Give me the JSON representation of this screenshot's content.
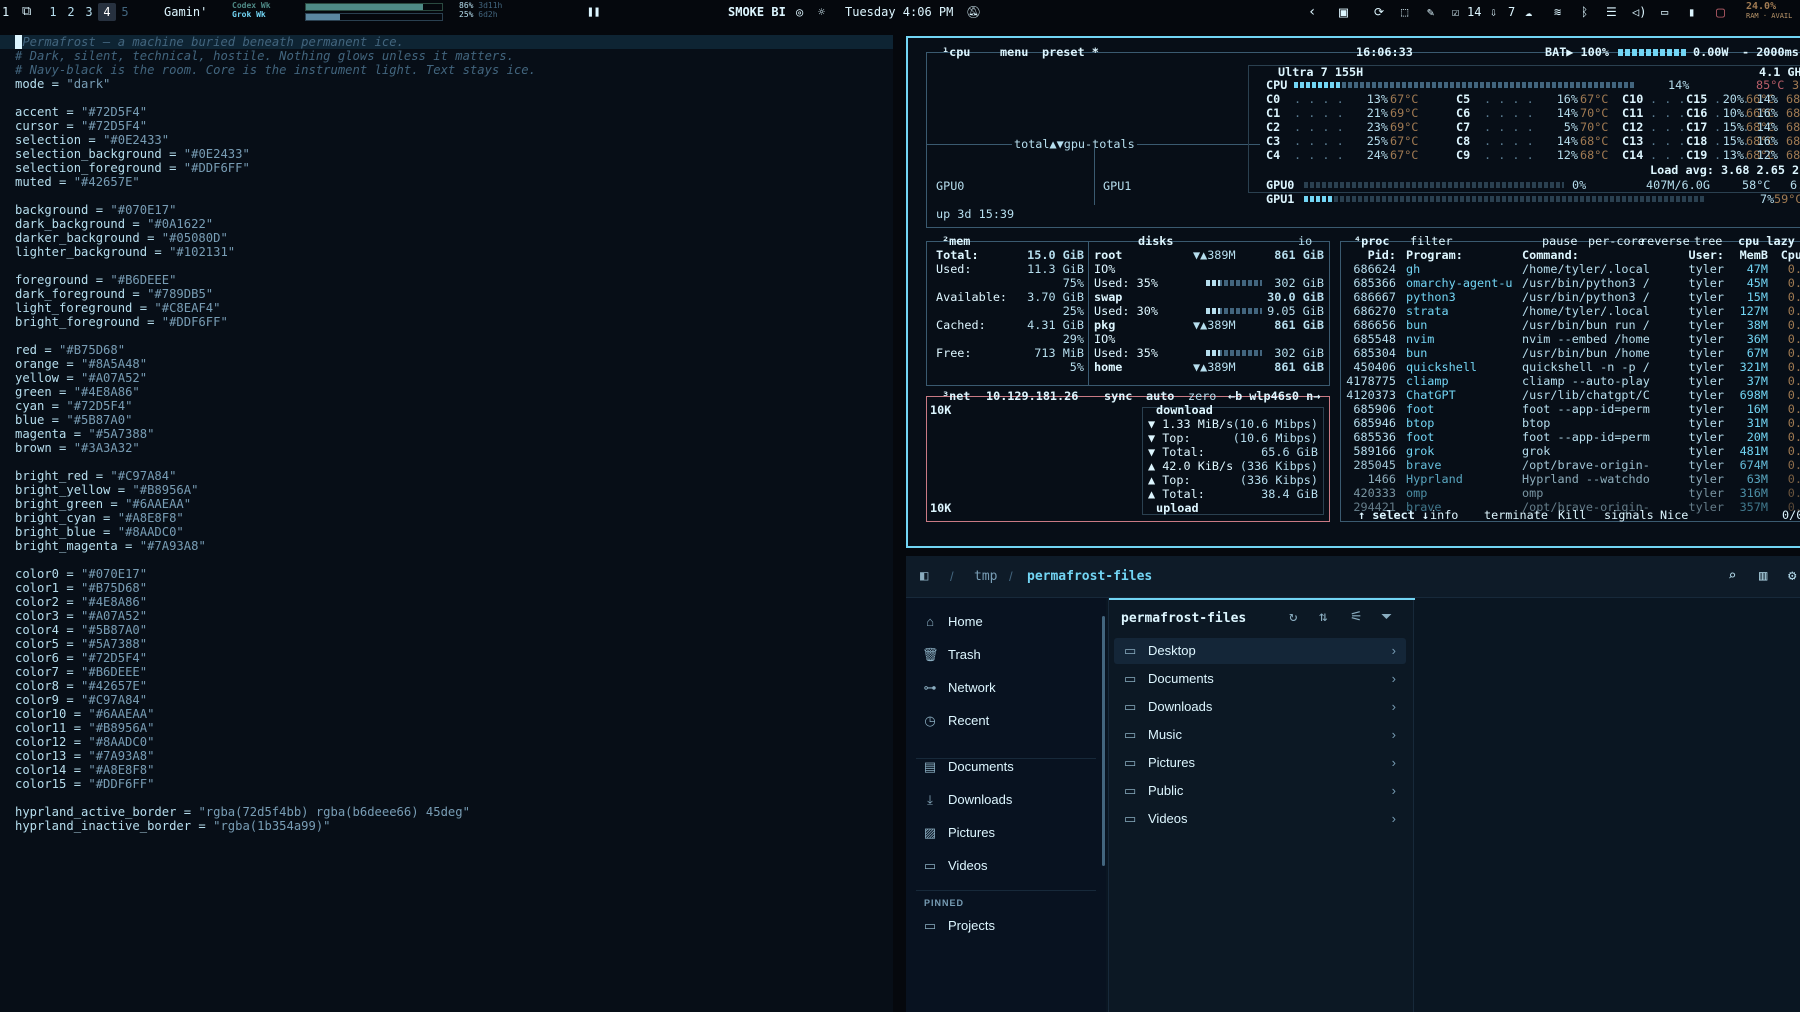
{
  "topbar": {
    "workspaces": [
      "1",
      "1",
      "2",
      "3",
      "4",
      "5"
    ],
    "active_workspace": "4",
    "window_title": "Gamin'",
    "usage_labels": [
      "Codex Wk",
      "Grok Wk"
    ],
    "usage_stats": [
      {
        "pct": "86%",
        "time": "3d11h"
      },
      {
        "pct": "25%",
        "time": "6d2h"
      }
    ],
    "usage_fill": [
      0.86,
      0.25
    ],
    "pause_icon": "pause-icon",
    "bi_label": "SMOKE BI",
    "clock": "Tuesday 4:06 PM",
    "tray_count_1": "14",
    "tray_count_2": "7",
    "cpu_pct": "24.0%",
    "ram_label": "RAM · AVAIL"
  },
  "editor": {
    "lines": [
      "Permafrost — a machine buried beneath permanent ice.",
      "# Dark, silent, technical, hostile. Nothing glows unless it matters.",
      "# Navy-black is the room. Core is the instrument light. Text stays ice.",
      "mode = \"dark\"",
      "",
      "accent = \"#72D5F4\"",
      "cursor = \"#72D5F4\"",
      "selection = \"#0E2433\"",
      "selection_background = \"#0E2433\"",
      "selection_foreground = \"#DDF6FF\"",
      "muted = \"#42657E\"",
      "",
      "background = \"#070E17\"",
      "dark_background = \"#0A1622\"",
      "darker_background = \"#05080D\"",
      "lighter_background = \"#102131\"",
      "",
      "foreground = \"#B6DEEE\"",
      "dark_foreground = \"#789DB5\"",
      "light_foreground = \"#C8EAF4\"",
      "bright_foreground = \"#DDF6FF\"",
      "",
      "red = \"#B75D68\"",
      "orange = \"#8A5A48\"",
      "yellow = \"#A07A52\"",
      "green = \"#4E8A86\"",
      "cyan = \"#72D5F4\"",
      "blue = \"#5B87A0\"",
      "magenta = \"#5A7388\"",
      "brown = \"#3A3A32\"",
      "",
      "bright_red = \"#C97A84\"",
      "bright_yellow = \"#B8956A\"",
      "bright_green = \"#6AAEAA\"",
      "bright_cyan = \"#A8E8F8\"",
      "bright_blue = \"#8AADC0\"",
      "bright_magenta = \"#7A93A8\"",
      "",
      "color0 = \"#070E17\"",
      "color1 = \"#B75D68\"",
      "color2 = \"#4E8A86\"",
      "color3 = \"#A07A52\"",
      "color4 = \"#5B87A0\"",
      "color5 = \"#5A7388\"",
      "color6 = \"#72D5F4\"",
      "color7 = \"#B6DEEE\"",
      "color8 = \"#42657E\"",
      "color9 = \"#C97A84\"",
      "color10 = \"#6AAEAA\"",
      "color11 = \"#B8956A\"",
      "color12 = \"#8AADC0\"",
      "color13 = \"#7A93A8\"",
      "color14 = \"#A8E8F8\"",
      "color15 = \"#DDF6FF\"",
      "",
      "hyprland_active_border = \"rgba(72d5f4bb) rgba(b6deee66) 45deg\"",
      "hyprland_inactive_border = \"rgba(1b354a99)\""
    ]
  },
  "btop": {
    "cpu_header": [
      "¹cpu",
      "menu",
      "preset *"
    ],
    "clock": "16:06:33",
    "battery": "BAT▶ 100%",
    "power": "0.00W",
    "interval": "- 2000ms",
    "gpu_totals": "total▲▼gpu-totals",
    "gpu0": "GPU0",
    "gpu1": "GPU1",
    "uptime": "up 3d 15:39",
    "cpu_model": "Ultra 7 155H",
    "cpu_freq": "4.1 GH",
    "cpu_total": {
      "label": "CPU",
      "pct": "14%",
      "temp": "85°C",
      "extra": "36"
    },
    "cores": [
      [
        "C0",
        "13%",
        "67°C",
        "C5",
        "16%",
        "67°C",
        "C10",
        "20%",
        "66°C",
        "C15",
        "14%",
        "68"
      ],
      [
        "C1",
        "21%",
        "69°C",
        "C6",
        "14%",
        "70°C",
        "C11",
        "10%",
        "66°C",
        "C16",
        "16%",
        "68"
      ],
      [
        "C2",
        "23%",
        "69°C",
        "C7",
        "5%",
        "70°C",
        "C12",
        "15%",
        "68°C",
        "C17",
        "14%",
        "68"
      ],
      [
        "C3",
        "25%",
        "67°C",
        "C8",
        "14%",
        "68°C",
        "C13",
        "15%",
        "68°C",
        "C18",
        "16%",
        "68"
      ],
      [
        "C4",
        "24%",
        "67°C",
        "C9",
        "12%",
        "68°C",
        "C14",
        "13%",
        "68°C",
        "C19",
        "12%",
        "68"
      ]
    ],
    "load_avg": "Load avg: 3.68 2.65 2.",
    "gpu0_row": {
      "label": "GPU0",
      "pct": "0%",
      "mem": "407M/6.0G",
      "temp": "58°C",
      "extra": "6."
    },
    "gpu1_row": {
      "label": "GPU1",
      "pct": "7%",
      "temp": "59°C"
    },
    "mem_header": "²mem",
    "mem": [
      [
        "Total:",
        "15.0 GiB"
      ],
      [
        "Used:",
        "11.3 GiB"
      ],
      [
        "",
        "75%"
      ],
      [
        "Available:",
        "3.70 GiB"
      ],
      [
        "",
        "25%"
      ],
      [
        "Cached:",
        "4.31 GiB"
      ],
      [
        "",
        "29%"
      ],
      [
        "Free:",
        "713 MiB"
      ],
      [
        "",
        "5%"
      ]
    ],
    "disks_header": "disks",
    "io_label": "io",
    "disks": [
      [
        "root",
        "▼▲389M",
        "861 GiB"
      ],
      [
        "IO%",
        "",
        ""
      ],
      [
        "Used: 35%",
        "",
        "302 GiB"
      ],
      [
        "swap",
        "",
        "30.0 GiB"
      ],
      [
        "Used: 30%",
        "",
        "9.05 GiB"
      ],
      [
        "pkg",
        "▼▲389M",
        "861 GiB"
      ],
      [
        "IO%",
        "",
        ""
      ],
      [
        "Used: 35%",
        "",
        "302 GiB"
      ],
      [
        "home",
        "▼▲389M",
        "861 GiB"
      ]
    ],
    "net_header": "³net",
    "net_ip": "10.129.181.26",
    "net_opts": [
      "sync",
      "auto",
      "zero",
      "←b wlp46s0 n→"
    ],
    "net_scale_top": "10K",
    "net_scale_bottom": "10K",
    "net": [
      [
        "download",
        ""
      ],
      [
        "▼ 1.33 MiB/s",
        "(10.6 Mibps)"
      ],
      [
        "▼ Top:",
        "(10.6 Mibps)"
      ],
      [
        "▼ Total:",
        "65.6 GiB"
      ],
      [
        "▲ 42.0 KiB/s",
        "(336 Kibps)"
      ],
      [
        "▲ Top:",
        "(336 Kibps)"
      ],
      [
        "▲ Total:",
        "38.4 GiB"
      ],
      [
        "upload",
        ""
      ]
    ],
    "proc_header": [
      "⁴proc",
      "filter",
      "pause",
      "per-core",
      "reverse",
      "tree",
      "cpu lazy"
    ],
    "proc_cols": [
      "Pid:",
      "Program:",
      "Command:",
      "User:",
      "MemB",
      "Cpu"
    ],
    "procs": [
      [
        "686624",
        "gh",
        "/home/tyler/.local",
        "tyler",
        "47M",
        "0."
      ],
      [
        "685366",
        "omarchy-agent-u",
        "/usr/bin/python3 /",
        "tyler",
        "45M",
        "0."
      ],
      [
        "686667",
        "python3",
        "/usr/bin/python3 /",
        "tyler",
        "15M",
        "0."
      ],
      [
        "686270",
        "strata",
        "/home/tyler/.local",
        "tyler",
        "127M",
        "0."
      ],
      [
        "686656",
        "bun",
        "/usr/bin/bun run /",
        "tyler",
        "38M",
        "0."
      ],
      [
        "685548",
        "nvim",
        "nvim --embed /home",
        "tyler",
        "36M",
        "0."
      ],
      [
        "685304",
        "bun",
        "/usr/bin/bun /home",
        "tyler",
        "67M",
        "0."
      ],
      [
        "450406",
        "quickshell",
        "quickshell -n -p /",
        "tyler",
        "321M",
        "0."
      ],
      [
        "4178775",
        "cliamp",
        "cliamp --auto-play",
        "tyler",
        "37M",
        "0."
      ],
      [
        "4120373",
        "ChatGPT",
        "/usr/lib/chatgpt/C",
        "tyler",
        "698M",
        "0."
      ],
      [
        "685906",
        "foot",
        "foot --app-id=perm",
        "tyler",
        "16M",
        "0."
      ],
      [
        "685946",
        "btop",
        "btop",
        "tyler",
        "31M",
        "0."
      ],
      [
        "685536",
        "foot",
        "foot --app-id=perm",
        "tyler",
        "20M",
        "0."
      ],
      [
        "589166",
        "grok",
        "grok",
        "tyler",
        "481M",
        "0."
      ],
      [
        "285045",
        "brave",
        "/opt/brave-origin-",
        "tyler",
        "674M",
        "0."
      ],
      [
        "1466",
        "Hyprland",
        "Hyprland --watchdo",
        "tyler",
        "63M",
        "0."
      ],
      [
        "420333",
        "omp",
        "omp",
        "tyler",
        "316M",
        "0."
      ],
      [
        "294421",
        "brave",
        "/opt/brave-origin-",
        "tyler",
        "357M",
        "0."
      ]
    ],
    "proc_footer": [
      "↑ select ↓",
      "info",
      "terminate",
      "Kill",
      "signals",
      "Nice",
      "0/0"
    ]
  },
  "files": {
    "path": [
      "/",
      "tmp",
      "/",
      "permafrost-files"
    ],
    "sidebar": [
      {
        "icon": "home-icon",
        "glyph": "⌂",
        "label": "Home"
      },
      {
        "icon": "trash-icon",
        "glyph": "🗑",
        "label": "Trash"
      },
      {
        "icon": "network-icon",
        "glyph": "⊶",
        "label": "Network"
      },
      {
        "icon": "recent-icon",
        "glyph": "◷",
        "label": "Recent"
      },
      {
        "icon": "documents-icon",
        "glyph": "▤",
        "label": "Documents"
      },
      {
        "icon": "downloads-icon",
        "glyph": "⤓",
        "label": "Downloads"
      },
      {
        "icon": "pictures-icon",
        "glyph": "▨",
        "label": "Pictures"
      },
      {
        "icon": "videos-icon",
        "glyph": "▭",
        "label": "Videos"
      }
    ],
    "pinned_label": "PINNED",
    "pinned": [
      {
        "icon": "folder-icon",
        "label": "Projects"
      }
    ],
    "pane_title": "permafrost-files",
    "folders": [
      "Desktop",
      "Documents",
      "Downloads",
      "Music",
      "Pictures",
      "Public",
      "Videos"
    ]
  }
}
